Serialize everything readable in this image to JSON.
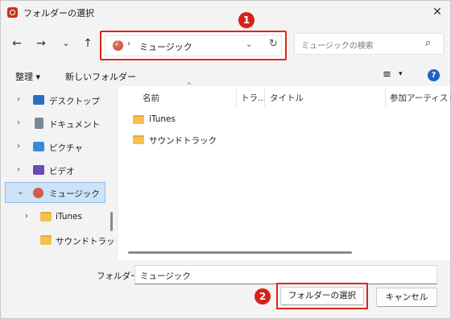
{
  "window": {
    "title": "フォルダーの選択",
    "close_glyph": "✕"
  },
  "nav": {
    "back": "←",
    "forward": "→",
    "recent": "⌄",
    "up": "↑"
  },
  "address": {
    "separator": "›",
    "path": "ミュージック",
    "dropdown_glyph": "⌄",
    "refresh_glyph": "↻"
  },
  "search": {
    "placeholder": "ミュージックの検索",
    "icon_glyph": "⌕"
  },
  "toolbar": {
    "organize": "整理 ▾",
    "new_folder": "新しいフォルダー",
    "view_glyph": "≡",
    "view_drop": "▾",
    "help": "?"
  },
  "badges": {
    "one": "1",
    "two": "2"
  },
  "tree": [
    {
      "chevron": "›",
      "label": "デスクトップ",
      "icon": "desktop-icon"
    },
    {
      "chevron": "›",
      "label": "ドキュメント",
      "icon": "documents-icon"
    },
    {
      "chevron": "›",
      "label": "ピクチャ",
      "icon": "pictures-icon"
    },
    {
      "chevron": "›",
      "label": "ビデオ",
      "icon": "videos-icon"
    },
    {
      "chevron": "⌄",
      "label": "ミュージック",
      "icon": "music-icon",
      "selected": true
    },
    {
      "chevron": "›",
      "label": "iTunes",
      "icon": "folder-icon"
    },
    {
      "chevron": "",
      "label": "サウンドトラック",
      "icon": "folder-icon"
    }
  ],
  "columns": [
    "名前",
    "トラ...",
    "タイトル",
    "参加アーティスト"
  ],
  "sort_glyph": "^",
  "files": [
    "iTunes",
    "サウンドトラック"
  ],
  "bottom": {
    "folder_label": "フォルダー:",
    "folder_value": "ミュージック",
    "select_button": "フォルダーの選択",
    "cancel_button": "キャンセル"
  },
  "colors": {
    "accent_red": "#e0241b",
    "selection": "#cde3f7",
    "folder": "#f4c24c",
    "help": "#1a63c6"
  }
}
